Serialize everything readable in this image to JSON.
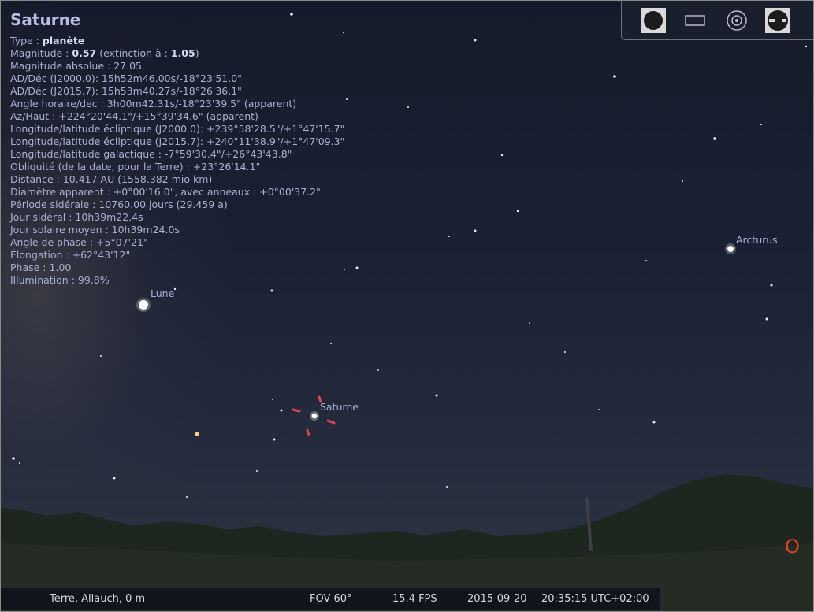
{
  "object": {
    "name": "Saturne",
    "rows": [
      {
        "label": "Type : ",
        "value": "planète"
      },
      {
        "label": "Magnitude : ",
        "value": "0.57",
        "extra": " (extinction à : ",
        "value2": "1.05",
        "end": ")"
      },
      {
        "text": "Magnitude absolue : 27.05"
      },
      {
        "text": "AD/Déc (J2000.0): 15h52m46.00s/-18°23'51.0\""
      },
      {
        "text": "AD/Déc (J2015.7): 15h53m40.27s/-18°26'36.1\""
      },
      {
        "text": "Angle horaire/dec : 3h00m42.31s/-18°23'39.5\" (apparent)"
      },
      {
        "text": "Az/Haut : +224°20'44.1\"/+15°39'34.6\" (apparent)"
      },
      {
        "text": "Longitude/latitude écliptique (J2000.0): +239°58'28.5\"/+1°47'15.7\""
      },
      {
        "text": "Longitude/latitude écliptique (J2015.7): +240°11'38.9\"/+1°47'09.3\""
      },
      {
        "text": "Longitude/latitude galactique : -7°59'30.4\"/+26°43'43.8\""
      },
      {
        "text": "Obliquité (de la date, pour la Terre) : +23°26'14.1\""
      },
      {
        "text": "Distance : 10.417 AU (1558.382 mio km)"
      },
      {
        "text": "Diamètre apparent : +0°00'16.0\", avec anneaux : +0°00'37.2\""
      },
      {
        "text": "Période sidérale : 10760.00 jours (29.459 a)"
      },
      {
        "text": "Jour sidéral : 10h39m22.4s"
      },
      {
        "text": "Jour solaire moyen : 10h39m24.0s"
      },
      {
        "text": "Angle de phase : +5°07'21\""
      },
      {
        "text": "Élongation : +62°43'12\""
      },
      {
        "text": "Phase : 1.00"
      },
      {
        "text": "Illumination : 99.8%"
      }
    ]
  },
  "sky_labels": {
    "moon": "Lune",
    "saturn": "Saturne",
    "arcturus": "Arcturus"
  },
  "compass": {
    "west": "O"
  },
  "toolbar": {
    "icons": [
      "filled-circle-icon",
      "rectangle-icon",
      "concentric-circles-icon",
      "eyepiece-icon"
    ]
  },
  "status": {
    "location": "Terre, Allauch, 0 m",
    "fov": "FOV 60°",
    "fps": "15.4 FPS",
    "date": "2015-09-20",
    "time": "20:35:15 UTC+02:00"
  },
  "colors": {
    "selection_marker": "#e0434e",
    "compass": "#e0431e",
    "label": "#a9b0d6"
  }
}
